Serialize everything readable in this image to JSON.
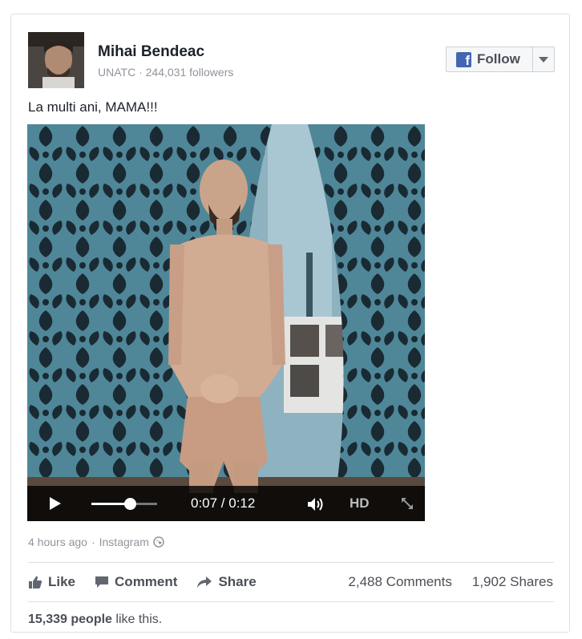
{
  "author": {
    "name": "Mihai Bendeac",
    "meta": "UNATC · 244,031 followers",
    "avatar": "profile-photo"
  },
  "follow": {
    "icon": "f",
    "label": "Follow"
  },
  "post": {
    "text": "La multi ani, MAMA!!!"
  },
  "video": {
    "time": "0:07 / 0:12",
    "progress": 0.58,
    "hd_label": "HD"
  },
  "meta": {
    "age": "4 hours ago",
    "source": "Instagram",
    "separator": "·"
  },
  "actions": {
    "like": "Like",
    "comment": "Comment",
    "share": "Share"
  },
  "counts": {
    "comments": "2,488 Comments",
    "shares": "1,902 Shares"
  },
  "likes": {
    "count": "15,339 people",
    "suffix": " like this."
  },
  "colors": {
    "brand": "#4267b2",
    "text": "#1d2129",
    "muted": "#90949c"
  }
}
